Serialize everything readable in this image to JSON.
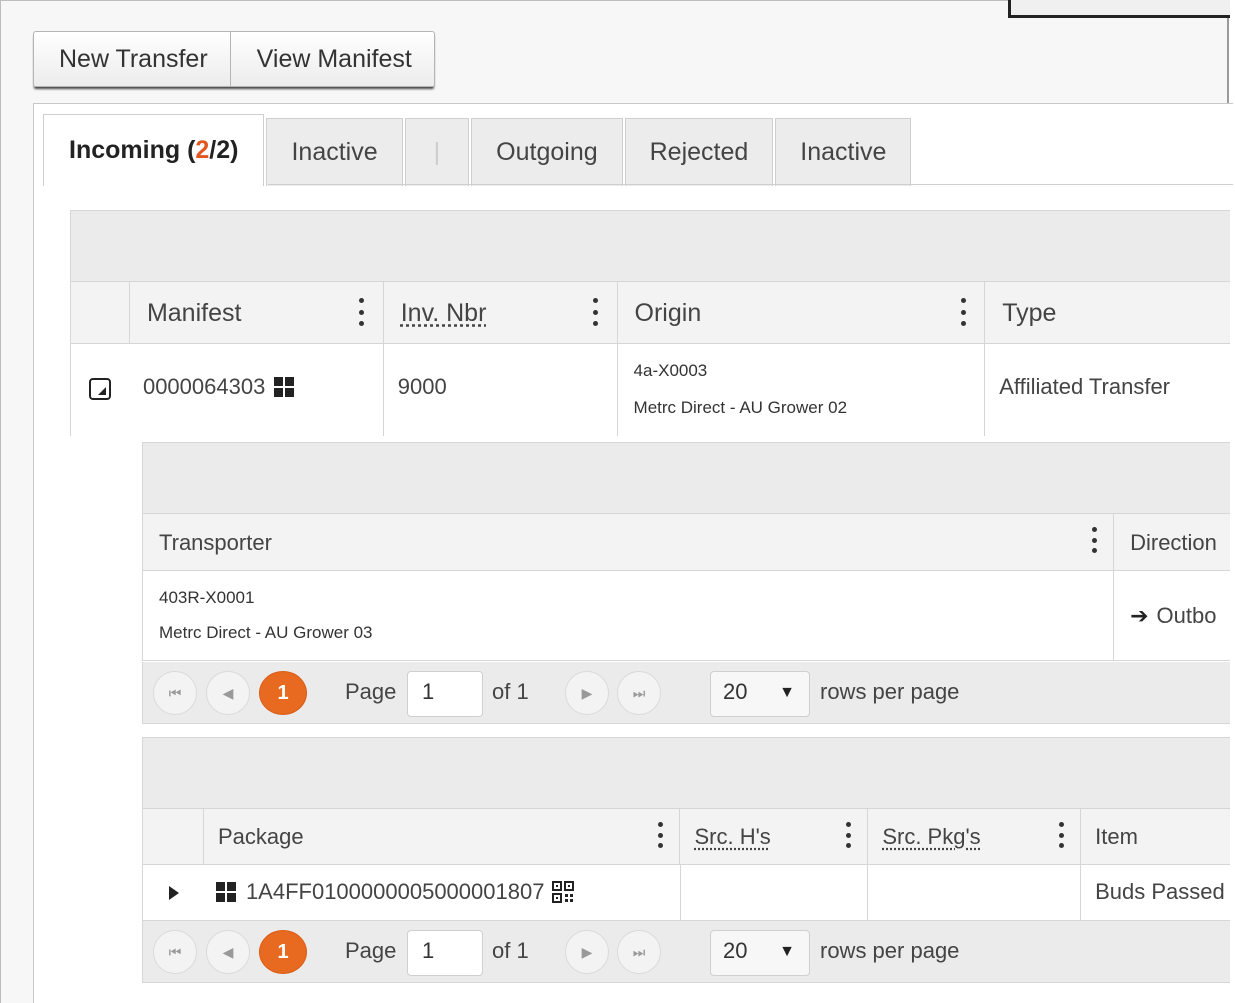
{
  "toolbar": {
    "new_transfer": "New Transfer",
    "view_manifest": "View Manifest"
  },
  "tabs": {
    "incoming_label": "Incoming",
    "incoming_count_open": "(",
    "incoming_count_current": "2",
    "incoming_count_rest": "/2)",
    "inactive_1": "Inactive",
    "separator": "|",
    "outgoing": "Outgoing",
    "rejected": "Rejected",
    "inactive_2": "Inactive"
  },
  "main_grid": {
    "columns": [
      "Manifest",
      "Inv. Nbr",
      "Origin",
      "Type"
    ],
    "row": {
      "manifest": "0000064303",
      "inv_nbr": "9000",
      "origin_license": "4a-X0003",
      "origin_name": "Metrc Direct - AU Grower 02",
      "type": "Affiliated Transfer"
    }
  },
  "transporter_grid": {
    "columns": [
      "Transporter",
      "Direction"
    ],
    "row": {
      "license": "403R-X0001",
      "name": "Metrc Direct - AU Grower 03",
      "direction": "Outbo"
    }
  },
  "pager": {
    "current_page_btn": "1",
    "page_label": "Page",
    "page_value": "1",
    "of_label": "of 1",
    "rows_value": "20",
    "rows_label": "rows per page"
  },
  "package_grid": {
    "columns": [
      "Package",
      "Src. H's",
      "Src. Pkg's",
      "Item"
    ],
    "row": {
      "package": "1A4FF0100000005000001807",
      "src_hs": "",
      "src_pkgs": "",
      "item": "Buds Passed"
    }
  },
  "colors": {
    "accent": "#e86a20",
    "count_highlight": "#e2571e"
  }
}
